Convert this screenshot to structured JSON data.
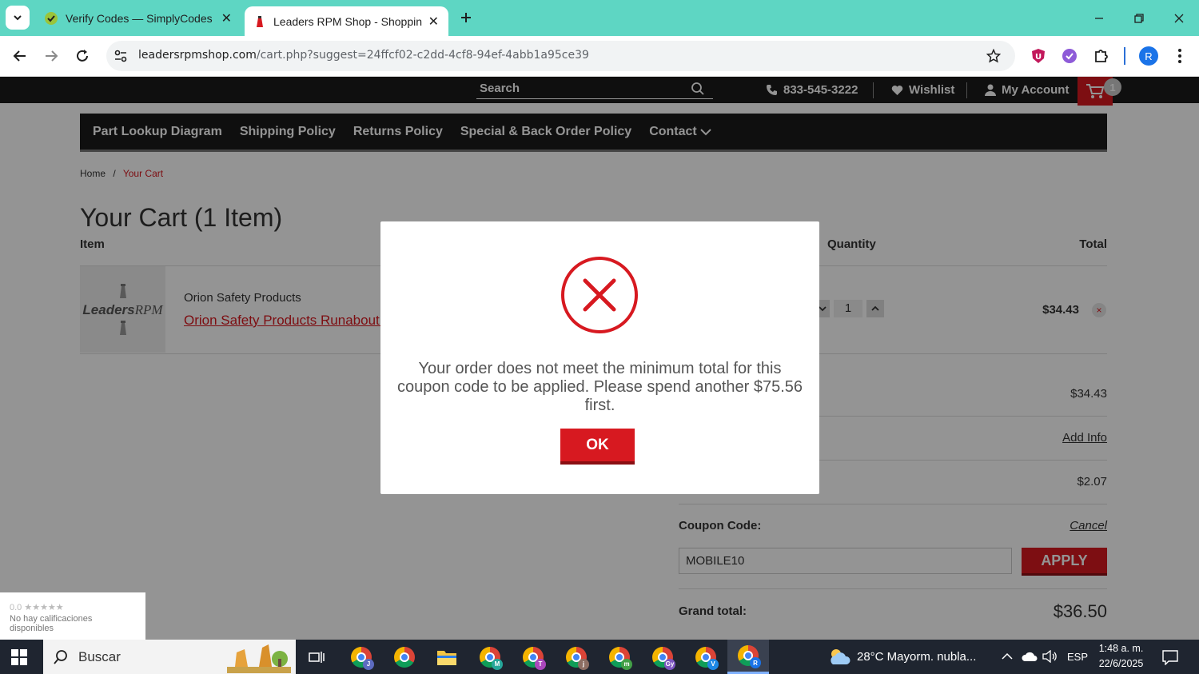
{
  "browser": {
    "tabs": [
      {
        "title": "Verify Codes — SimplyCodes",
        "active": false
      },
      {
        "title": "Leaders RPM Shop - Shopping Cart",
        "active": true
      }
    ],
    "url_domain": "leadersrpmshop.com",
    "url_path": "/cart.php?suggest=24ffcf02-c2dd-4cf8-94ef-4abb1a95ce39",
    "profile_initial": "R"
  },
  "site": {
    "search_placeholder": "Search",
    "phone": "833-545-3222",
    "wishlist": "Wishlist",
    "account": "My Account",
    "cart_count": "1",
    "nav": [
      "Part Lookup Diagram",
      "Shipping Policy",
      "Returns Policy",
      "Special & Back Order Policy",
      "Contact"
    ],
    "breadcrumb": {
      "home": "Home",
      "separator": "/",
      "current": "Your Cart"
    },
    "cart_title": "Your Cart (1 Item)",
    "columns": {
      "item": "Item",
      "quantity": "Quantity",
      "total": "Total"
    },
    "item": {
      "thumb_brand": "Leaders",
      "thumb_brand_suffix": "RPM",
      "brand": "Orion Safety Products",
      "name": "Orion Safety Products Runabout I",
      "quantity": "1",
      "total": "$34.43",
      "remove": "×"
    },
    "summary": {
      "subtotal": "$34.43",
      "shipping_link": "Add Info",
      "tax": "$2.07",
      "coupon_label": "Coupon Code:",
      "coupon_cancel": "Cancel",
      "coupon_value": "MOBILE10",
      "apply": "APPLY",
      "grand_total_label": "Grand total:",
      "grand_total": "$36.50"
    },
    "ratings_widget": {
      "score": "0.0 ★★★★★",
      "text": "No hay calificaciones disponibles"
    }
  },
  "modal": {
    "icon": "error-x-icon",
    "message": "Your order does not meet the minimum total for this coupon code to be applied. Please spend another $75.56 first.",
    "ok": "OK"
  },
  "taskbar": {
    "search": "Buscar",
    "weather": "28°C  Mayorm. nubla...",
    "lang": "ESP",
    "time": "1:48 a. m.",
    "date": "22/6/2025",
    "apps": [
      "J",
      "",
      "folder",
      "M",
      "T",
      "j",
      "m",
      "Gy",
      "V",
      "R"
    ]
  },
  "colors": {
    "accent": "#d71920",
    "tabstrip": "#5ed6c3",
    "dark": "#1b1b1b"
  }
}
